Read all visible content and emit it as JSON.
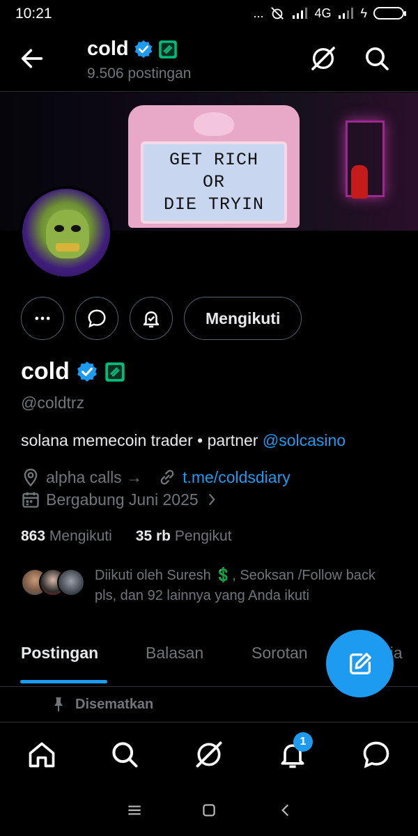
{
  "status_bar": {
    "time": "10:21",
    "network": "4G",
    "dots": "..."
  },
  "header": {
    "title": "cold",
    "subtitle": "9.506 postingan"
  },
  "banner": {
    "sign_lines": [
      "GET RICH",
      "OR",
      "DIE TRYIN"
    ]
  },
  "actions": {
    "follow_label": "Mengikuti"
  },
  "profile": {
    "name": "cold",
    "handle": "@coldtrz",
    "bio_text": "solana memecoin trader • partner ",
    "bio_link": "@solcasino",
    "location": "alpha calls →",
    "website": "t.me/coldsdiary",
    "joined": "Bergabung Juni 2025",
    "following_count": "863",
    "following_label": "Mengikuti",
    "followers_count": "35 rb",
    "followers_label": "Pengikut",
    "followed_by": "Diikuti oleh Suresh 💲, Seoksan /Follow back pls, dan 92 lainnya yang Anda ikuti"
  },
  "tabs": [
    "Postingan",
    "Balasan",
    "Sorotan",
    "Media"
  ],
  "pinned_label": "Disematkan",
  "notifications_badge": "1",
  "colors": {
    "accent": "#1d9bf0",
    "verified": "#1d9bf0",
    "badge_green": "#00ba7c",
    "background": "#000000"
  },
  "icons": {
    "back": "arrow-left-icon",
    "grok": "grok-icon",
    "search": "search-icon",
    "more": "more-icon",
    "message": "message-icon",
    "notify": "bell-check-icon",
    "location": "location-icon",
    "link": "link-icon",
    "calendar": "calendar-icon",
    "pin": "pin-icon",
    "compose": "compose-icon",
    "home": "home-icon",
    "notifications": "bell-icon",
    "messages": "message-icon"
  }
}
